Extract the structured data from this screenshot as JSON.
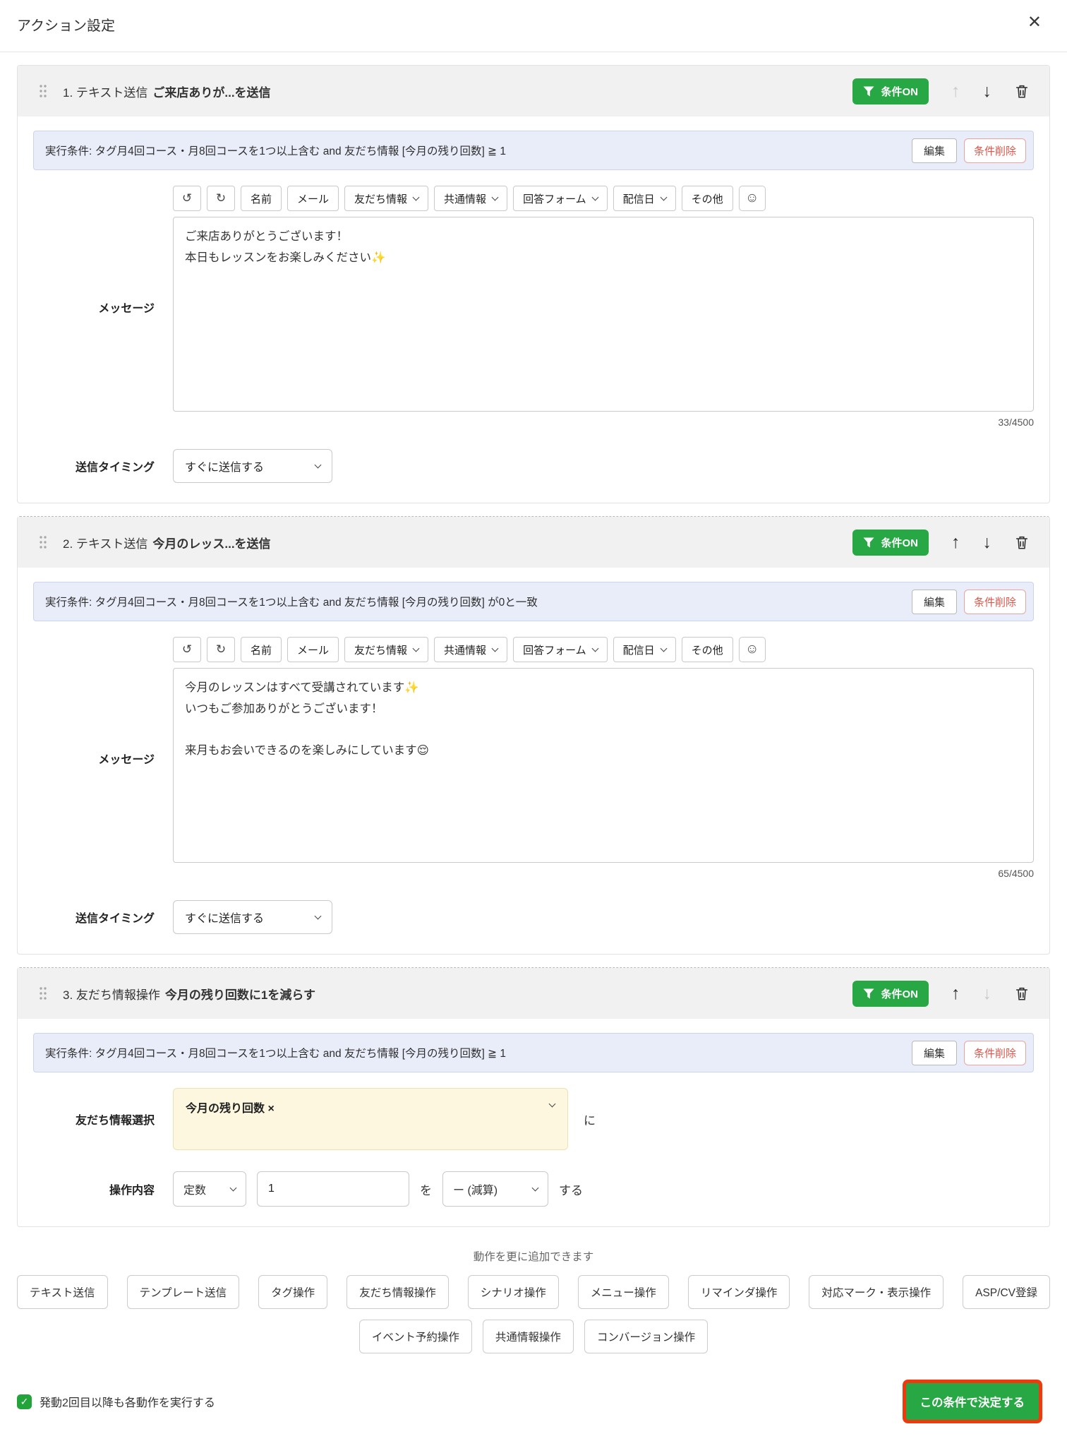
{
  "modal": {
    "title": "アクション設定",
    "close_icon": "✕"
  },
  "common": {
    "condition_badge": "条件ON",
    "edit_label": "編集",
    "delete_condition_label": "条件削除",
    "message_label": "メッセージ",
    "timing_label": "送信タイミング",
    "up_icon": "↑",
    "down_icon": "↓",
    "toolbar": {
      "undo_icon": "↺",
      "redo_icon": "↻",
      "emoji_icon": "☺",
      "items": [
        "名前",
        "メール",
        "友だち情報",
        "共通情報",
        "回答フォーム",
        "配信日",
        "その他"
      ]
    },
    "check_icon": "✓",
    "colors": {
      "accent_green": "#28a745",
      "highlight_red": "#ee3a0c",
      "condition_bg": "#e9ecf9",
      "warning_yellow_bg": "#fcf7de",
      "delete_red": "#e0564a"
    }
  },
  "actions": [
    {
      "type_label": "1. テキスト送信",
      "name": "ご来店ありが...を送信",
      "condition": "実行条件: タグ月4回コース・月8回コースを1つ以上含む and 友だち情報 [今月の残り回数] ≧ 1",
      "message": "ご来店ありがとうございます！\n本日もレッスンをお楽しみください✨",
      "char_count": "33/4500",
      "timing_value": "すぐに送信する"
    },
    {
      "type_label": "2. テキスト送信",
      "name": "今月のレッス...を送信",
      "condition": "実行条件: タグ月4回コース・月8回コースを1つ以上含む and 友だち情報 [今月の残り回数] が0と一致",
      "message": "今月のレッスンはすべて受講されています✨\nいつもご参加ありがとうございます！\n\n来月もお会いできるのを楽しみにしています😌",
      "char_count": "65/4500",
      "timing_value": "すぐに送信する"
    },
    {
      "type_label": "3. 友だち情報操作",
      "name": "今月の残り回数に1を減らす",
      "condition": "実行条件: タグ月4回コース・月8回コースを1つ以上含む and 友だち情報 [今月の残り回数] ≧ 1",
      "field_select_label": "友だち情報選択",
      "field_value": "今月の残り回数 ×",
      "particle_ni": "に",
      "operation_label": "操作内容",
      "operand_type": "定数",
      "operand_value": "1",
      "particle_wo": "を",
      "operator": "ー (減算)",
      "operation_suffix": "する"
    }
  ],
  "add_more": {
    "hint": "動作を更に追加できます",
    "row1": [
      "テキスト送信",
      "テンプレート送信",
      "タグ操作",
      "友だち情報操作",
      "シナリオ操作",
      "メニュー操作",
      "リマインダ操作",
      "対応マーク・表示操作",
      "ASP/CV登録"
    ],
    "row2": [
      "イベント予約操作",
      "共通情報操作",
      "コンバージョン操作"
    ]
  },
  "footer": {
    "checkbox_label": "発動2回目以降も各動作を実行する",
    "checkbox_checked": true,
    "submit_label": "この条件で決定する"
  }
}
